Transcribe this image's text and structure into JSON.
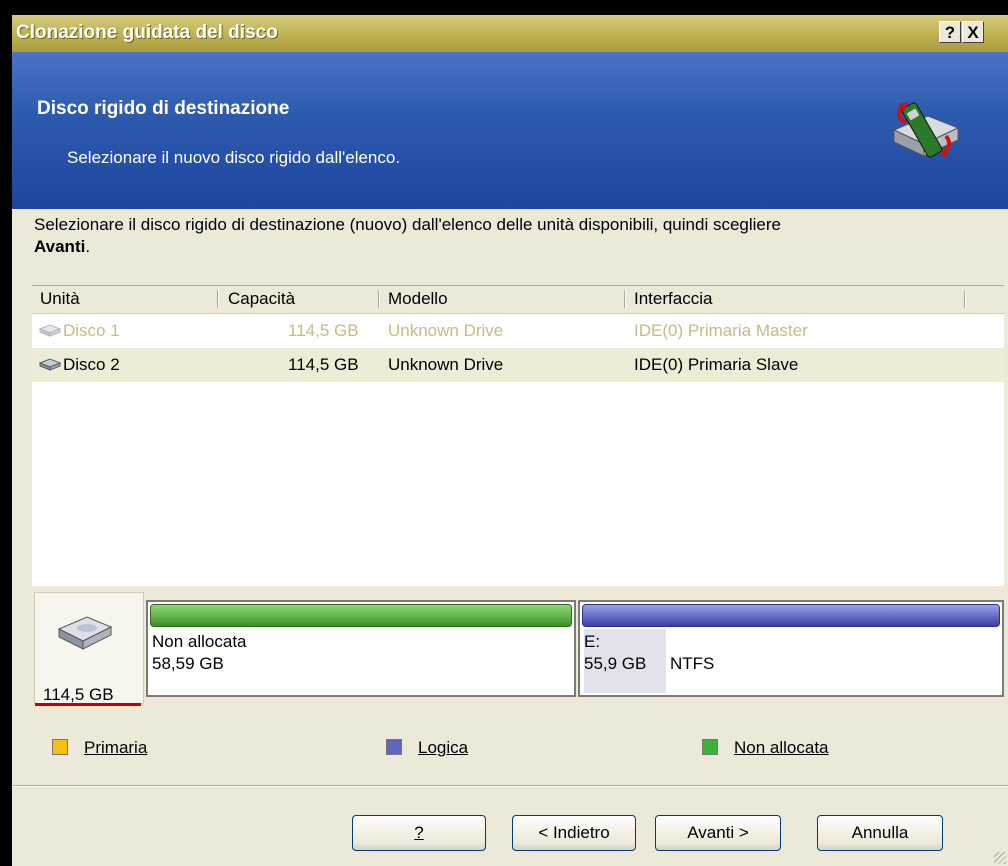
{
  "window": {
    "title": "Clonazione guidata del disco",
    "help_btn": "?",
    "close_btn": "X"
  },
  "header": {
    "title": "Disco rigido di destinazione",
    "subtitle": "Selezionare il nuovo disco rigido dall'elenco."
  },
  "instruction": {
    "text": "Selezionare il disco rigido di destinazione (nuovo) dall'elenco delle unità disponibili, quindi scegliere",
    "bold": "Avanti",
    "end": "."
  },
  "table": {
    "columns": [
      "Unità",
      "Capacità",
      "Modello",
      "Interfaccia"
    ],
    "rows": [
      {
        "unit": "Disco 1",
        "capacity": "114,5 GB",
        "model": "Unknown Drive",
        "interface": "IDE(0) Primaria Master",
        "state": "disabled"
      },
      {
        "unit": "Disco 2",
        "capacity": "114,5 GB",
        "model": "Unknown Drive",
        "interface": "IDE(0) Primaria Slave",
        "state": "selected"
      }
    ]
  },
  "disk_map": {
    "disk_size": "114,5 GB",
    "partitions": [
      {
        "line1": "Non allocata",
        "line2": "58,59 GB",
        "color": "#5cb044"
      },
      {
        "line1": "E:",
        "line2": "55,9 GB",
        "fs": "NTFS",
        "color": "#5e66c2"
      }
    ]
  },
  "legend": [
    {
      "label": "Primaria",
      "color": "#f4c00c"
    },
    {
      "label": "Logica",
      "color": "#5e66c2"
    },
    {
      "label": "Non allocata",
      "color": "#3cb43c"
    }
  ],
  "buttons": {
    "help": "?",
    "back": "< Indietro",
    "next": "Avanti >",
    "cancel": "Annulla"
  }
}
